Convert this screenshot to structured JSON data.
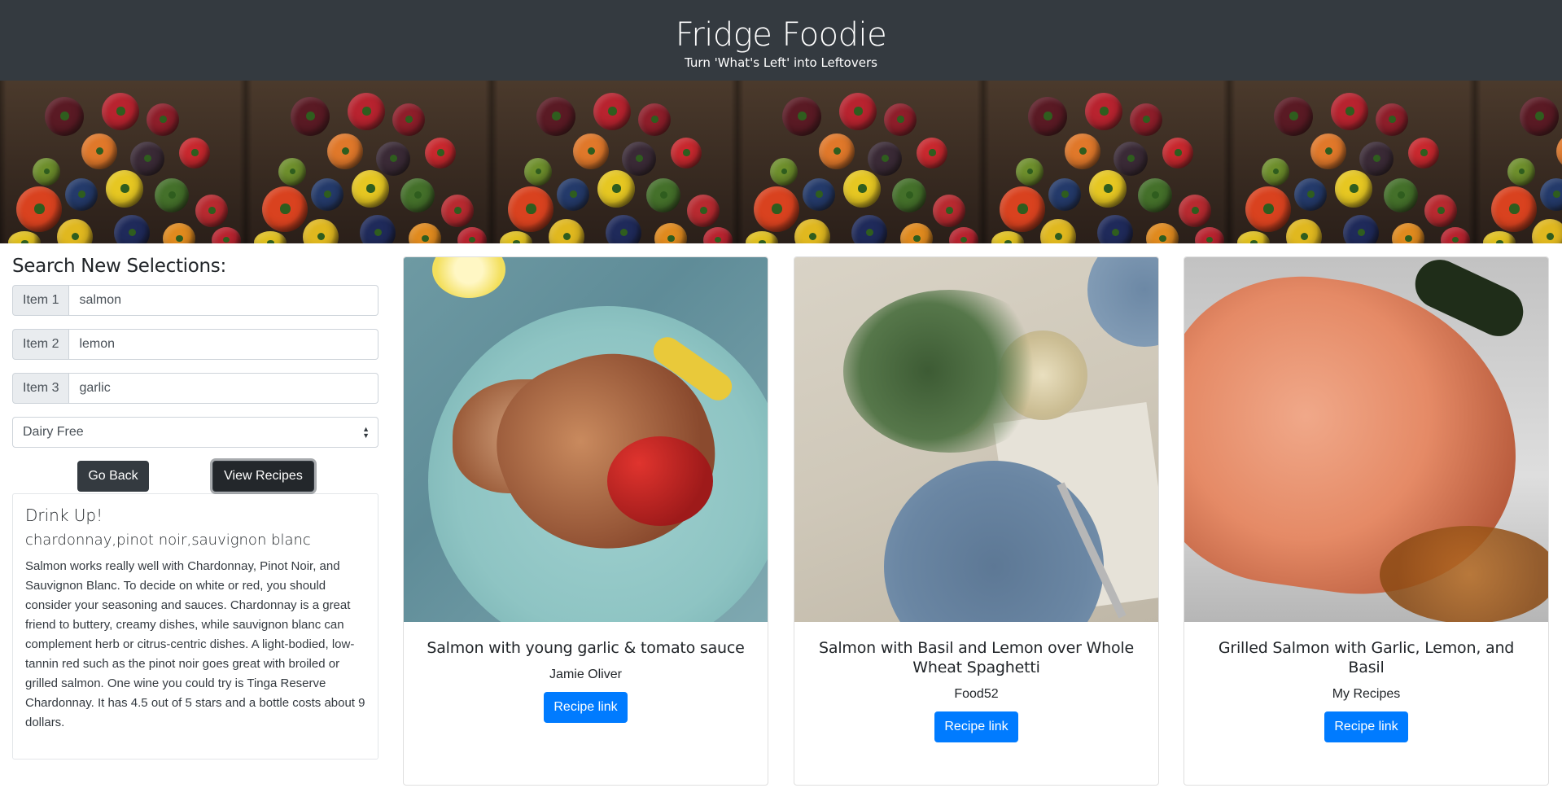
{
  "header": {
    "title": "Fridge Foodie",
    "tagline": "Turn 'What's Left' into Leftovers"
  },
  "search": {
    "heading": "Search New Selections:",
    "items": [
      {
        "label": "Item 1",
        "value": "salmon"
      },
      {
        "label": "Item 2",
        "value": "lemon"
      },
      {
        "label": "Item 3",
        "value": "garlic"
      }
    ],
    "diet_select": "Dairy Free",
    "go_back_label": "Go Back",
    "view_recipes_label": "View Recipes"
  },
  "wine": {
    "heading": "Drink Up!",
    "pairings": "chardonnay,pinot noir,sauvignon blanc",
    "description": "Salmon works really well with Chardonnay, Pinot Noir, and Sauvignon Blanc. To decide on white or red, you should consider your seasoning and sauces. Chardonnay is a great friend to buttery, creamy dishes, while sauvignon blanc can complement herb or citrus-centric dishes. A light-bodied, low-tannin red such as the pinot noir goes great with broiled or grilled salmon. One wine you could try is Tinga Reserve Chardonnay. It has 4.5 out of 5 stars and a bottle costs about 9 dollars."
  },
  "recipes": [
    {
      "title": "Salmon with young garlic & tomato sauce",
      "source": "Jamie Oliver",
      "link_label": "Recipe link"
    },
    {
      "title": "Salmon with Basil and Lemon over Whole Wheat Spaghetti",
      "source": "Food52",
      "link_label": "Recipe link"
    },
    {
      "title": "Grilled Salmon with Garlic, Lemon, and Basil",
      "source": "My Recipes",
      "link_label": "Recipe link"
    }
  ],
  "colors": {
    "header_bg": "#343a40",
    "primary": "#007bff",
    "dark_button": "#343a40"
  }
}
